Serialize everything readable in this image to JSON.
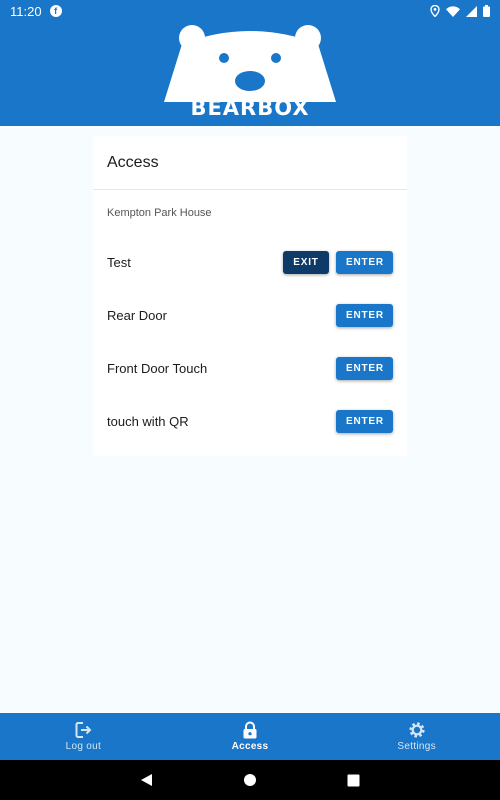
{
  "status_bar": {
    "time": "11:20",
    "app_badge": "f"
  },
  "brand": {
    "logo_text": "BEARBOX"
  },
  "card": {
    "title": "Access",
    "group_label": "Kempton Park House",
    "doors": [
      {
        "name": "Test",
        "exit_label": "EXIT",
        "enter_label": "ENTER"
      },
      {
        "name": "Rear Door",
        "enter_label": "ENTER"
      },
      {
        "name": "Front Door Touch",
        "enter_label": "ENTER"
      },
      {
        "name": "touch with QR",
        "enter_label": "ENTER"
      }
    ]
  },
  "bottom_nav": {
    "items": [
      {
        "label": "Log out",
        "icon": "logout-icon"
      },
      {
        "label": "Access",
        "icon": "lock-icon",
        "active": true
      },
      {
        "label": "Settings",
        "icon": "gear-icon"
      }
    ]
  },
  "colors": {
    "primary": "#1976c8",
    "exit_button": "#0d3a66",
    "background": "#f7fcff"
  }
}
